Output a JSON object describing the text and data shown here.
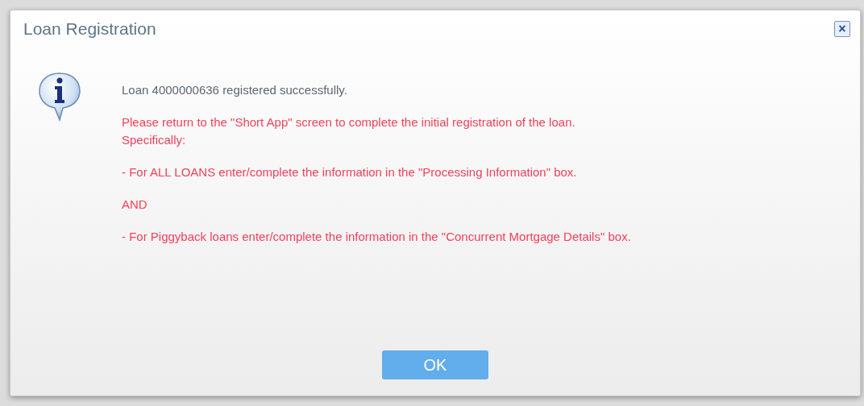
{
  "dialog": {
    "title": "Loan Registration",
    "close_label": "×",
    "messages": [
      {
        "kind": "info",
        "lines": [
          "Loan 4000000636 registered successfully."
        ]
      },
      {
        "kind": "warning",
        "lines": [
          "Please return to the \"Short App\" screen to complete the initial registration of the loan.",
          "Specifically:"
        ]
      },
      {
        "kind": "warning",
        "lines": [
          "- For ALL LOANS enter/complete the information in the \"Processing Information\" box."
        ]
      },
      {
        "kind": "warning",
        "lines": [
          "AND"
        ]
      },
      {
        "kind": "warning",
        "lines": [
          "- For Piggyback loans enter/complete the information in the \"Concurrent Mortgage Details\" box."
        ]
      }
    ],
    "buttons": [
      "OK"
    ]
  }
}
